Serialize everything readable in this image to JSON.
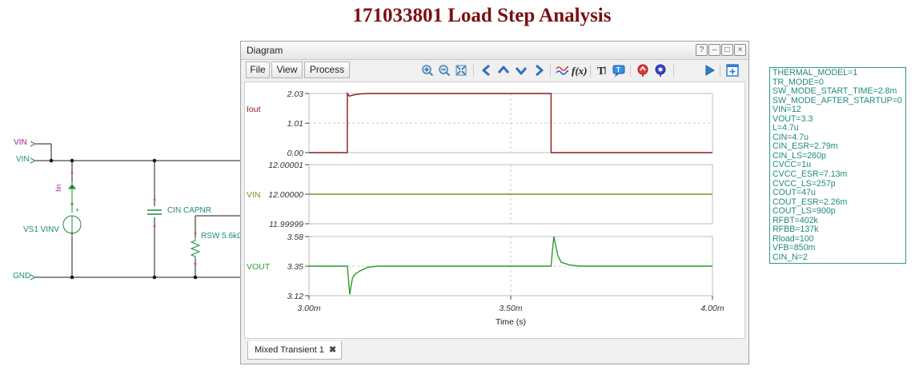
{
  "page": {
    "title": "171033801 Load Step Analysis"
  },
  "schematic": {
    "vin_net_label": "VIN",
    "vin_label": "VIN",
    "gnd_label": "GND",
    "source_label": "VS1 VINV",
    "current_probe_label": "Iin",
    "capacitor_label": "CIN CAPNR",
    "resistor_label": "RSW 5.6kΩ",
    "plus_sign": "+",
    "colors": {
      "wire": "#1a1a1a",
      "component": "#1f8a3a",
      "label": "#1f8a7a",
      "net_label": "#a020a0",
      "pin": "#d05050"
    }
  },
  "diagram": {
    "title": "Diagram",
    "buttons": {
      "help": "?",
      "minimize": "–",
      "maximize": "□",
      "close": "×"
    },
    "menu": [
      {
        "label": "File"
      },
      {
        "label": "View"
      },
      {
        "label": "Process"
      }
    ],
    "toolbar": [
      {
        "icon": "zoom-in-icon"
      },
      {
        "icon": "zoom-out-icon"
      },
      {
        "icon": "zoom-fit-icon"
      },
      {
        "icon": "arrow-left-icon"
      },
      {
        "icon": "arrow-up-icon"
      },
      {
        "icon": "arrow-down-icon"
      },
      {
        "icon": "arrow-right-icon"
      },
      {
        "icon": "waveform-icon"
      },
      {
        "icon": "function-icon"
      },
      {
        "icon": "text-icon"
      },
      {
        "icon": "comment-icon"
      },
      {
        "icon": "marker-red-icon"
      },
      {
        "icon": "marker-blue-icon"
      },
      {
        "icon": "play-icon"
      },
      {
        "icon": "add-window-icon"
      }
    ],
    "tab_label": "Mixed Transient 1",
    "tab_close": "✖"
  },
  "chart_data": {
    "type": "line",
    "xlabel": "Time (s)",
    "x_ticks": [
      "3.00m",
      "3.50m",
      "4.00m"
    ],
    "x_tick_values": [
      0.003,
      0.0035,
      0.004
    ],
    "xlim": [
      0.003,
      0.004
    ],
    "grid": true,
    "panels": [
      {
        "name": "Iout",
        "color": "#8b1a1a",
        "ylim": [
          0.0,
          2.03
        ],
        "y_ticks": [
          "2.03",
          "1.01",
          "0.00"
        ],
        "y_tick_values": [
          2.03,
          1.01,
          0.0
        ],
        "points": [
          [
            0.003,
            0.0
          ],
          [
            0.003095,
            0.0
          ],
          [
            0.003095,
            2.03
          ],
          [
            0.0031,
            1.94
          ],
          [
            0.003105,
            1.96
          ],
          [
            0.00311,
            1.98
          ],
          [
            0.00312,
            2.0
          ],
          [
            0.00313,
            2.02
          ],
          [
            0.003145,
            2.03
          ],
          [
            0.0036,
            2.03
          ],
          [
            0.0036,
            0.0
          ],
          [
            0.004,
            0.0
          ]
        ]
      },
      {
        "name": "VIN",
        "color": "#8a8a20",
        "ylim": [
          11.99999,
          12.00001
        ],
        "y_ticks": [
          "12.00001",
          "12.00000",
          "11.99999"
        ],
        "y_tick_values": [
          12.00001,
          12.0,
          11.99999
        ],
        "points": [
          [
            0.003,
            12.0
          ],
          [
            0.004,
            12.0
          ]
        ]
      },
      {
        "name": "VOUT",
        "color": "#2e9a2e",
        "ylim": [
          3.12,
          3.58
        ],
        "y_ticks": [
          "3.58",
          "3.35",
          "3.12"
        ],
        "y_tick_values": [
          3.58,
          3.35,
          3.12
        ],
        "points": [
          [
            0.003,
            3.35
          ],
          [
            0.003095,
            3.35
          ],
          [
            0.003098,
            3.24
          ],
          [
            0.003101,
            3.13
          ],
          [
            0.003104,
            3.19
          ],
          [
            0.003108,
            3.26
          ],
          [
            0.003115,
            3.29
          ],
          [
            0.003125,
            3.31
          ],
          [
            0.003145,
            3.34
          ],
          [
            0.00317,
            3.35
          ],
          [
            0.0036,
            3.35
          ],
          [
            0.003603,
            3.46
          ],
          [
            0.003607,
            3.58
          ],
          [
            0.003611,
            3.52
          ],
          [
            0.003617,
            3.43
          ],
          [
            0.003625,
            3.38
          ],
          [
            0.003645,
            3.36
          ],
          [
            0.00367,
            3.35
          ],
          [
            0.004,
            3.35
          ]
        ]
      }
    ]
  },
  "params": [
    "THERMAL_MODEL=1",
    "TR_MODE=0",
    "SW_MODE_START_TIME=2.8m",
    "SW_MODE_AFTER_STARTUP=0",
    "VIN=12",
    "VOUT=3.3",
    "L=4.7u",
    "CIN=4.7u",
    "CIN_ESR=2.79m",
    "CIN_LS=260p",
    "CVCC=1u",
    "CVCC_ESR=7.13m",
    "CVCC_LS=257p",
    "COUT=47u",
    "COUT_ESR=2.26m",
    "COUT_LS=900p",
    "RFBT=402k",
    "RFBB=137k",
    "Rload=100",
    "VFB=850m",
    "CIN_N=2"
  ]
}
